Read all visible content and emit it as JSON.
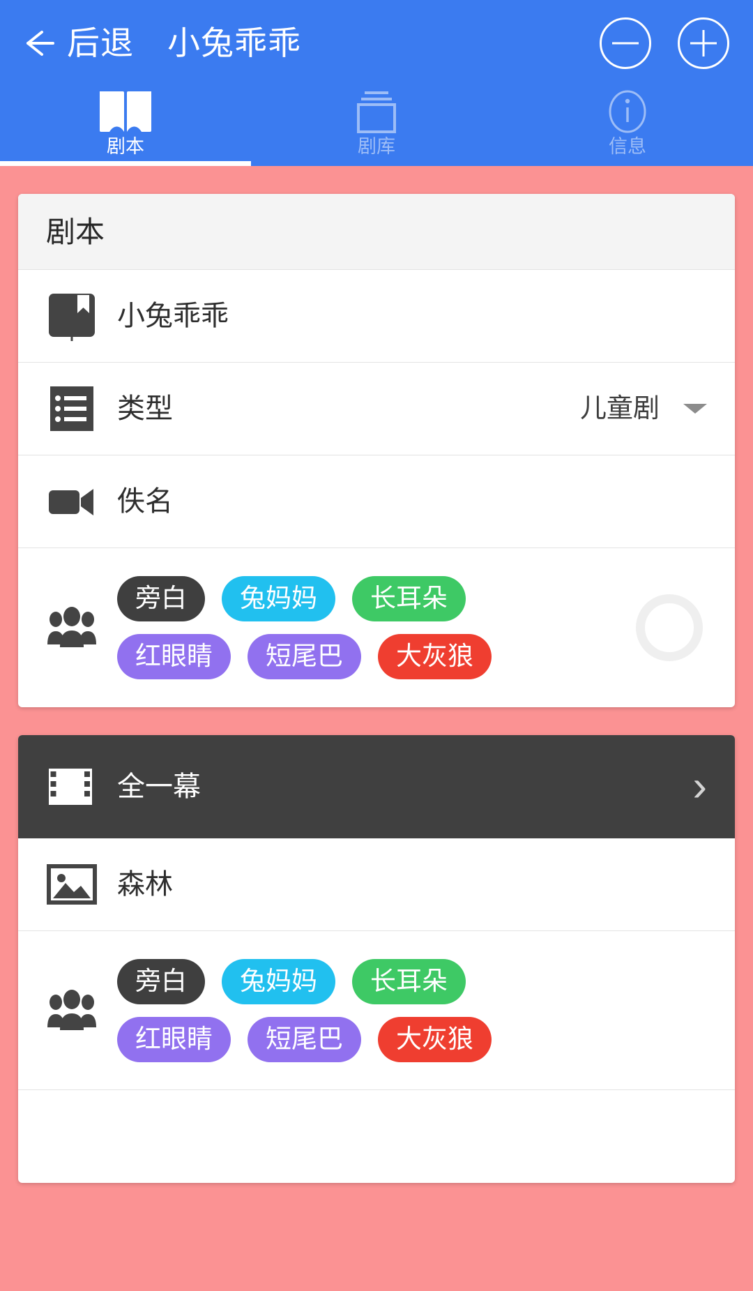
{
  "colors": {
    "brand_blue": "#3b7bf0",
    "page_background": "#fb9293",
    "dark_panel": "#404040",
    "icon_dark": "#444444"
  },
  "header": {
    "back_label": "后退",
    "title": "小兔乖乖",
    "minus_button": "—",
    "plus_button": "+",
    "back_icon": "arrow-left-icon",
    "minus_icon": "minus-circle-icon",
    "plus_icon": "plus-circle-icon"
  },
  "tabs": [
    {
      "label": "剧本",
      "icon": "open-book-icon",
      "active": true
    },
    {
      "label": "剧库",
      "icon": "library-stack-icon",
      "active": false
    },
    {
      "label": "信息",
      "icon": "info-circle-icon",
      "active": false
    }
  ],
  "script_card": {
    "header": "剧本",
    "rows": [
      {
        "icon": "book-bookmark-icon",
        "label": "小兔乖乖"
      },
      {
        "icon": "list-icon",
        "label": "类型",
        "value": "儿童剧",
        "caret": "chevron-down-icon"
      },
      {
        "icon": "video-camera-icon",
        "label": "佚名"
      }
    ],
    "roles_icon": "people-group-icon",
    "roles": [
      {
        "name": "旁白",
        "color": "#3f3f3f"
      },
      {
        "name": "兔妈妈",
        "color": "#21c0ef"
      },
      {
        "name": "长耳朵",
        "color": "#3ec965"
      },
      {
        "name": "红眼睛",
        "color": "#9171ef"
      },
      {
        "name": "短尾巴",
        "color": "#9171ef"
      },
      {
        "name": "大灰狼",
        "color": "#ef3e30"
      }
    ],
    "add_role_button": "add-role-ring"
  },
  "scene_card": {
    "header": "全一幕",
    "header_icon": "film-strip-icon",
    "header_chevron": "chevron-right-icon",
    "rows": [
      {
        "icon": "image-icon",
        "label": "森林"
      }
    ],
    "roles_icon": "people-group-icon",
    "roles": [
      {
        "name": "旁白",
        "color": "#3f3f3f"
      },
      {
        "name": "兔妈妈",
        "color": "#21c0ef"
      },
      {
        "name": "长耳朵",
        "color": "#3ec965"
      },
      {
        "name": "红眼睛",
        "color": "#9171ef"
      },
      {
        "name": "短尾巴",
        "color": "#9171ef"
      },
      {
        "name": "大灰狼",
        "color": "#ef3e30"
      }
    ]
  }
}
